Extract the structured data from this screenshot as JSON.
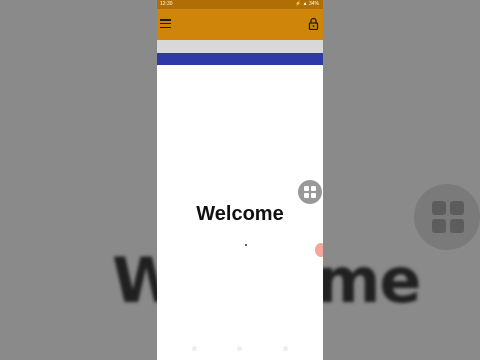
{
  "status_bar": {
    "time": "12:30",
    "right": "⚡ ▲ 34%"
  },
  "app_bar": {
    "menu_icon": "hamburger-icon",
    "lock_icon": "lock-icon",
    "colors": {
      "status": "#b06f06",
      "appbar": "#cf8509",
      "accent_bar": "#2f39a6"
    }
  },
  "main": {
    "welcome_text": "Welcome"
  },
  "background": {
    "blurred_text": "Welcome"
  },
  "floating_button": {
    "icon": "grid-apps-icon"
  }
}
